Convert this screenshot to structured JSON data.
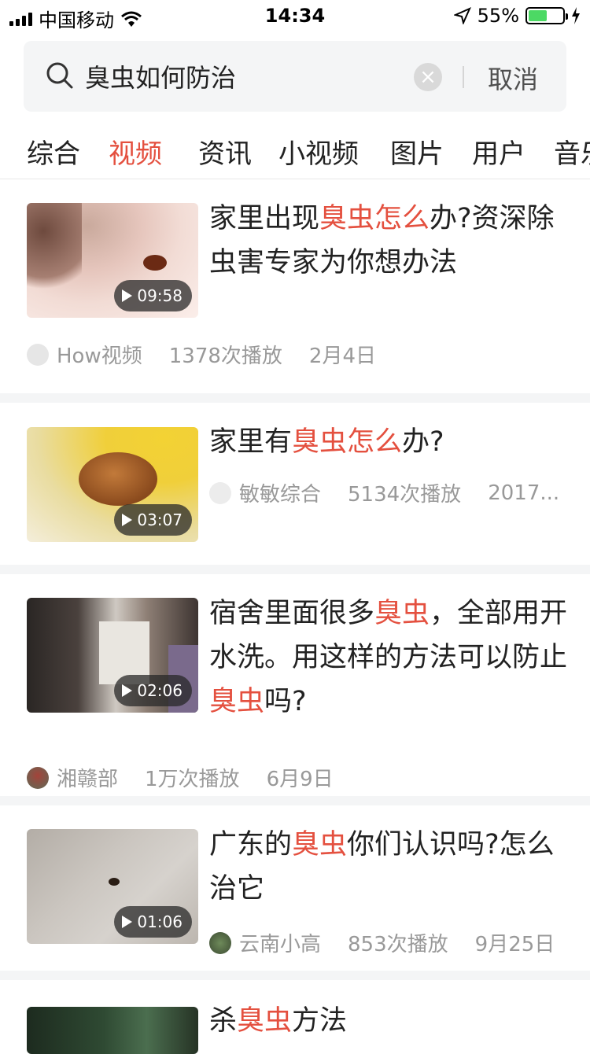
{
  "status_bar": {
    "carrier": "中国移动",
    "time": "14:34",
    "battery": "55%"
  },
  "search": {
    "query": "臭虫如何防治",
    "cancel_label": "取消"
  },
  "tabs": [
    "综合",
    "视频",
    "资讯",
    "小视频",
    "图片",
    "用户",
    "音乐"
  ],
  "active_tab_index": 1,
  "colors": {
    "accent": "#e4503f",
    "meta_text": "#999999",
    "separator": "#f4f5f6"
  },
  "results": [
    {
      "title_parts": [
        "家里出现",
        "臭虫怎么",
        "办?资深除虫害专家为你想办法"
      ],
      "duration": "09:58",
      "author": "How视频",
      "plays": "1378次播放",
      "date": "2月4日"
    },
    {
      "title_parts": [
        "家里有",
        "臭虫怎么",
        "办?"
      ],
      "duration": "03:07",
      "author": "敏敏综合",
      "plays": "5134次播放",
      "date": "2017..."
    },
    {
      "title_parts": [
        "宿舍里面很多",
        "臭虫",
        "，全部用开水洗。用这样的方法可以防止",
        "臭虫",
        "吗?"
      ],
      "duration": "02:06",
      "author": "湘赣部",
      "plays": "1万次播放",
      "date": "6月9日"
    },
    {
      "title_parts": [
        "广东的",
        "臭虫",
        "你们认识吗?怎么治它"
      ],
      "duration": "01:06",
      "author": "云南小高",
      "plays": "853次播放",
      "date": "9月25日"
    },
    {
      "title_parts": [
        "杀",
        "臭虫",
        "方法"
      ]
    }
  ]
}
